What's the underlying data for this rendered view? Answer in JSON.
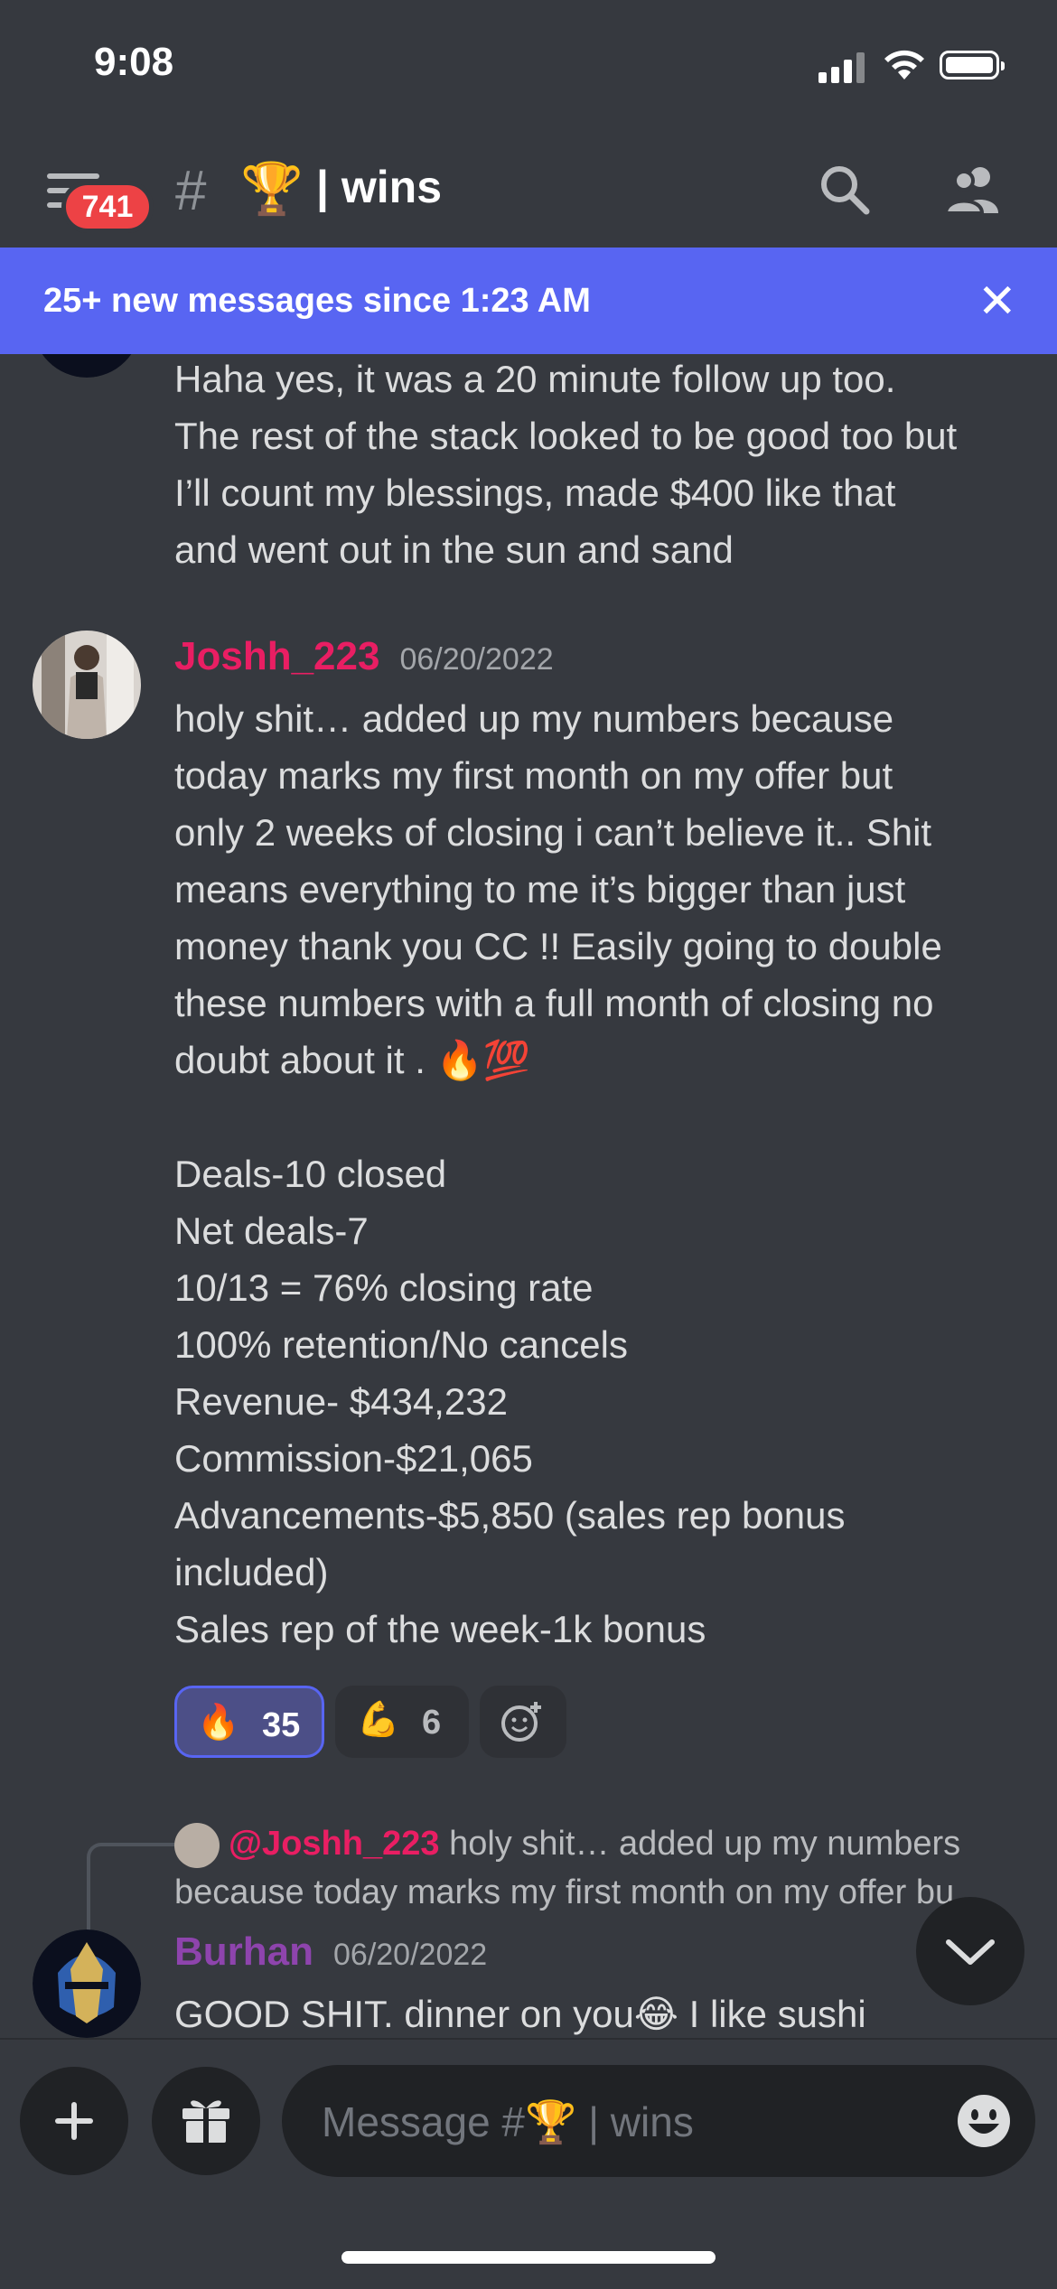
{
  "status_bar": {
    "time": "9:08"
  },
  "header": {
    "badge": "741",
    "channel_hash": "#",
    "channel_emoji": "🏆",
    "channel_name": "| wins"
  },
  "banner": {
    "text": "25+ new messages since 1:23 AM",
    "close": "✕"
  },
  "messages": [
    {
      "text": "Haha yes, it was a 20 minute follow up too.\nThe rest of the stack looked to be good too but\nI’ll count my blessings, made $400 like that\nand went out in the sun and sand"
    },
    {
      "author": "Joshh_223",
      "author_color": "#e91e63",
      "timestamp": "06/20/2022",
      "text": "holy shit… added up my numbers because\ntoday marks my first month on my offer but\nonly 2 weeks of closing i can’t believe it.. Shit\nmeans everything to me it’s bigger than just\nmoney thank you CC !! Easily going to double\nthese numbers with a full month of closing no\ndoubt about it . 🔥💯\n\nDeals-10 closed\nNet deals-7\n10/13 = 76% closing rate\n100% retention/No cancels\nRevenue- $434,232\nCommission-$21,065\nAdvancements-$5,850 (sales rep bonus\nincluded)\nSales rep of the week-1k bonus",
      "reactions": [
        {
          "emoji": "🔥",
          "count": "35",
          "active": true
        },
        {
          "emoji": "💪",
          "count": "6",
          "active": false
        }
      ]
    },
    {
      "reply_mention": "@Joshh_223",
      "reply_preview": "holy shit… added up my numbers because today marks my first month on my offer bu…",
      "author": "Burhan",
      "author_color": "#8e44ad",
      "timestamp": "06/20/2022",
      "text": "GOOD SHIT. dinner on you😂 I like sushi"
    }
  ],
  "composer": {
    "placeholder": "Message #🏆 | wins"
  }
}
